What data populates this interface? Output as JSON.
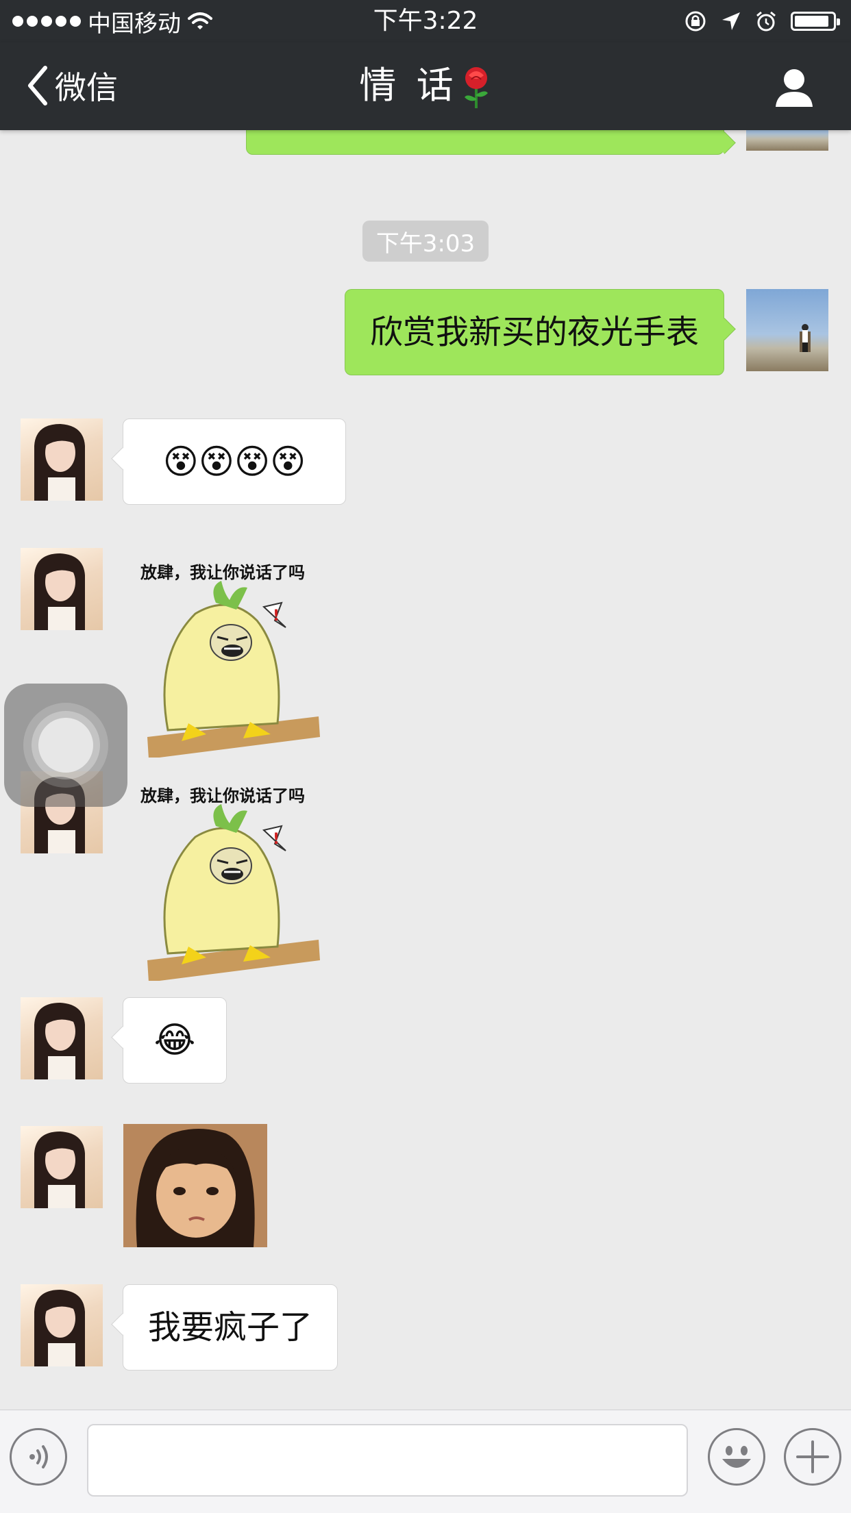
{
  "status_bar": {
    "carrier": "中国移动",
    "time": "下午3:22",
    "battery_level": 0.9
  },
  "nav": {
    "back_label": "微信",
    "title": "情 话"
  },
  "chat": {
    "timestamp": "下午3:03",
    "messages": [
      {
        "sender": "me",
        "type": "text",
        "text": "欣赏我新买的夜光手表"
      },
      {
        "sender": "her",
        "type": "emoji",
        "text": "😵😵😵😵"
      },
      {
        "sender": "her",
        "type": "sticker",
        "caption": "放肆，我让你说话了吗"
      },
      {
        "sender": "her",
        "type": "sticker",
        "caption": "放肆，我让你说话了吗"
      },
      {
        "sender": "her",
        "type": "emoji",
        "text": "😂"
      },
      {
        "sender": "her",
        "type": "image"
      },
      {
        "sender": "her",
        "type": "text",
        "text": "我要疯子了"
      }
    ]
  },
  "input_bar": {
    "text_value": "",
    "icons": [
      "voice-icon",
      "emoji-icon",
      "plus-icon"
    ]
  },
  "colors": {
    "bar_bg": "#2b2e31",
    "chat_bg": "#ebebeb",
    "my_bubble": "#9ee65b",
    "her_bubble": "#ffffff"
  }
}
